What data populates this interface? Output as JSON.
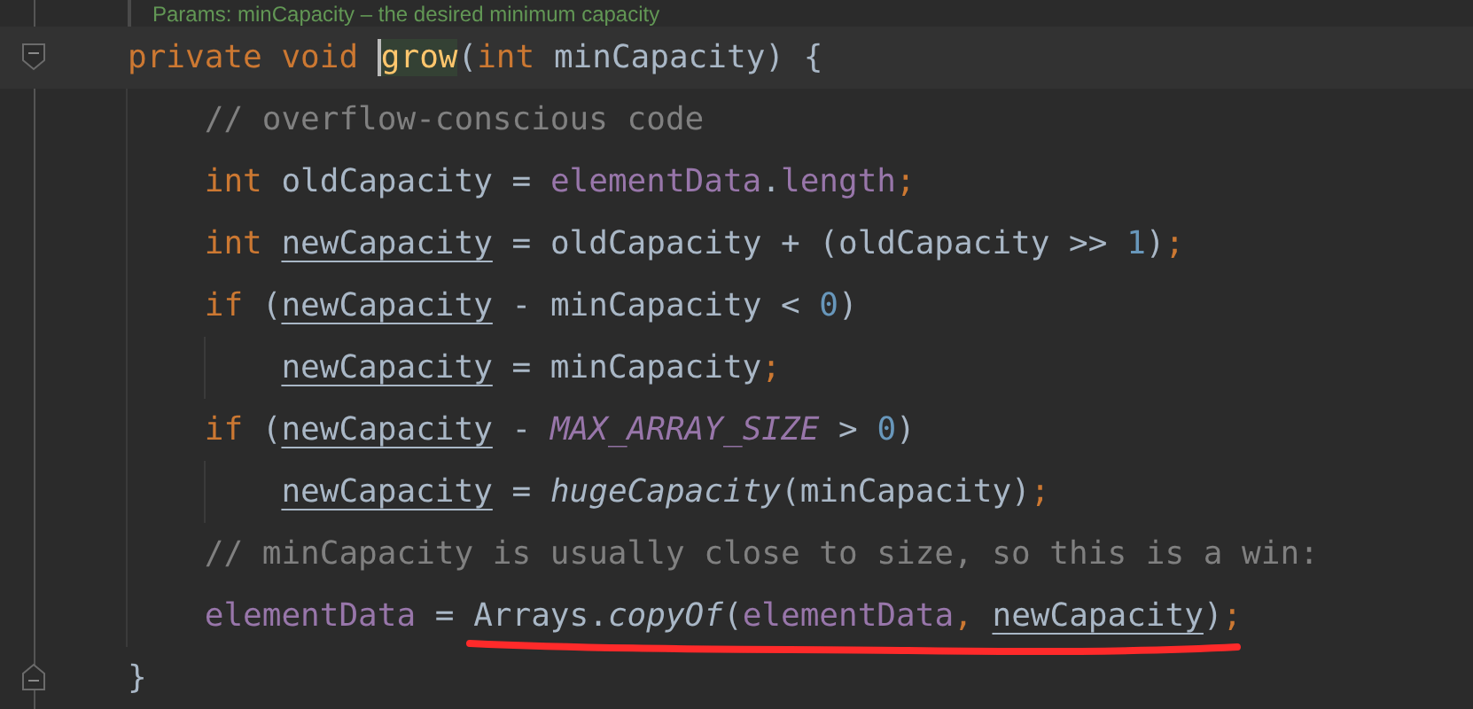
{
  "doc_comment": "Params: minCapacity – the desired minimum capacity",
  "lines": [
    {
      "current": true,
      "fold_start": true,
      "marked": false,
      "tokens": [
        {
          "kind": "keyword",
          "text": "private void "
        },
        {
          "kind": "method-decl",
          "text": "grow"
        },
        {
          "kind": "text",
          "text": "("
        },
        {
          "kind": "keyword",
          "text": "int "
        },
        {
          "kind": "text",
          "text": "minCapacity) {"
        }
      ]
    },
    {
      "current": false,
      "marked": false,
      "tokens": [
        {
          "kind": "comment",
          "text": "    // overflow-conscious code"
        }
      ]
    },
    {
      "current": false,
      "marked": false,
      "tokens": [
        {
          "kind": "keyword",
          "text": "    int "
        },
        {
          "kind": "text",
          "text": "oldCapacity = "
        },
        {
          "kind": "field",
          "text": "elementData"
        },
        {
          "kind": "text",
          "text": "."
        },
        {
          "kind": "field",
          "text": "length"
        },
        {
          "kind": "keyword",
          "text": ";"
        }
      ]
    },
    {
      "current": false,
      "marked": false,
      "tokens": [
        {
          "kind": "keyword",
          "text": "    int "
        },
        {
          "kind": "mutable",
          "text": "newCapacity"
        },
        {
          "kind": "text",
          "text": " = oldCapacity + (oldCapacity >> "
        },
        {
          "kind": "number",
          "text": "1"
        },
        {
          "kind": "text",
          "text": ")"
        },
        {
          "kind": "keyword",
          "text": ";"
        }
      ]
    },
    {
      "current": false,
      "marked": false,
      "tokens": [
        {
          "kind": "keyword",
          "text": "    if "
        },
        {
          "kind": "text",
          "text": "("
        },
        {
          "kind": "mutable",
          "text": "newCapacity"
        },
        {
          "kind": "text",
          "text": " - minCapacity < "
        },
        {
          "kind": "number",
          "text": "0"
        },
        {
          "kind": "text",
          "text": ")"
        }
      ]
    },
    {
      "current": false,
      "marked": false,
      "tokens": [
        {
          "kind": "mutable",
          "text": "        newCapacity"
        },
        {
          "kind": "text",
          "text": " = minCapacity"
        },
        {
          "kind": "keyword",
          "text": ";"
        }
      ]
    },
    {
      "current": false,
      "marked": false,
      "tokens": [
        {
          "kind": "keyword",
          "text": "    if "
        },
        {
          "kind": "text",
          "text": "("
        },
        {
          "kind": "mutable",
          "text": "newCapacity"
        },
        {
          "kind": "text",
          "text": " - "
        },
        {
          "kind": "constant",
          "text": "MAX_ARRAY_SIZE"
        },
        {
          "kind": "text",
          "text": " > "
        },
        {
          "kind": "number",
          "text": "0"
        },
        {
          "kind": "text",
          "text": ")"
        }
      ]
    },
    {
      "current": false,
      "marked": false,
      "tokens": [
        {
          "kind": "mutable",
          "text": "        newCapacity"
        },
        {
          "kind": "text",
          "text": " = "
        },
        {
          "kind": "static-call",
          "text": "hugeCapacity"
        },
        {
          "kind": "text",
          "text": "(minCapacity)"
        },
        {
          "kind": "keyword",
          "text": ";"
        }
      ]
    },
    {
      "current": false,
      "marked": false,
      "tokens": [
        {
          "kind": "comment",
          "text": "    // minCapacity is usually close to size, so this is a win:"
        }
      ]
    },
    {
      "current": false,
      "marked": true,
      "tokens": [
        {
          "kind": "field",
          "text": "    elementData"
        },
        {
          "kind": "text",
          "text": " = Arrays."
        },
        {
          "kind": "static-call",
          "text": "copyOf"
        },
        {
          "kind": "text",
          "text": "("
        },
        {
          "kind": "field",
          "text": "elementData"
        },
        {
          "kind": "keyword",
          "text": ", "
        },
        {
          "kind": "mutable",
          "text": "newCapacity"
        },
        {
          "kind": "text",
          "text": ")"
        },
        {
          "kind": "keyword",
          "text": ";"
        }
      ]
    },
    {
      "current": false,
      "fold_end": true,
      "marked": false,
      "tokens": [
        {
          "kind": "text",
          "text": "}"
        }
      ]
    }
  ]
}
